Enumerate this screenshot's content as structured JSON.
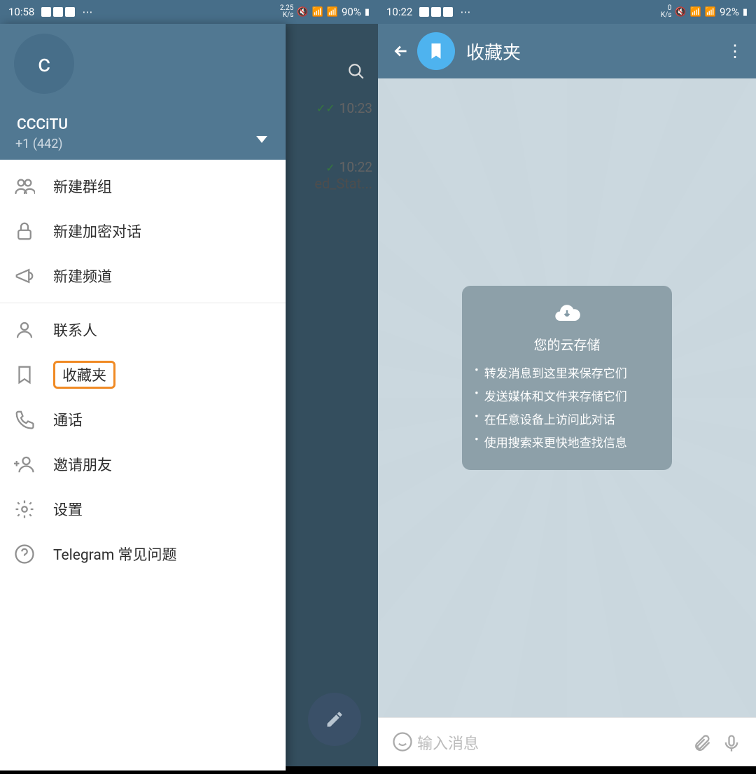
{
  "left": {
    "status": {
      "time": "10:58",
      "speed": "2.25\nK/s",
      "battery": "90%"
    },
    "chat_list": [
      {
        "time": "10:23"
      },
      {
        "time": "10:22",
        "preview": "ed_Stat..."
      }
    ],
    "drawer": {
      "avatar_letter": "c",
      "name": "CCCiTU",
      "phone": "+1 (442)",
      "items": [
        {
          "label": "新建群组",
          "icon": "group"
        },
        {
          "label": "新建加密对话",
          "icon": "lock"
        },
        {
          "label": "新建频道",
          "icon": "megaphone"
        },
        {
          "sep": true
        },
        {
          "label": "联系人",
          "icon": "person"
        },
        {
          "label": "收藏夹",
          "icon": "bookmark",
          "highlight": true
        },
        {
          "label": "通话",
          "icon": "phone"
        },
        {
          "label": "邀请朋友",
          "icon": "adduser"
        },
        {
          "label": "设置",
          "icon": "gear"
        },
        {
          "label": "Telegram 常见问题",
          "icon": "help"
        }
      ]
    }
  },
  "right": {
    "status": {
      "time": "10:22",
      "speed": "0\nK/s",
      "battery": "92%"
    },
    "header": {
      "title": "收藏夹"
    },
    "card": {
      "title": "您的云存储",
      "bullets": [
        "转发消息到这里来保存它们",
        "发送媒体和文件来存储它们",
        "在任意设备上访问此对话",
        "使用搜索来更快地查找信息"
      ]
    },
    "input_placeholder": "输入消息"
  }
}
